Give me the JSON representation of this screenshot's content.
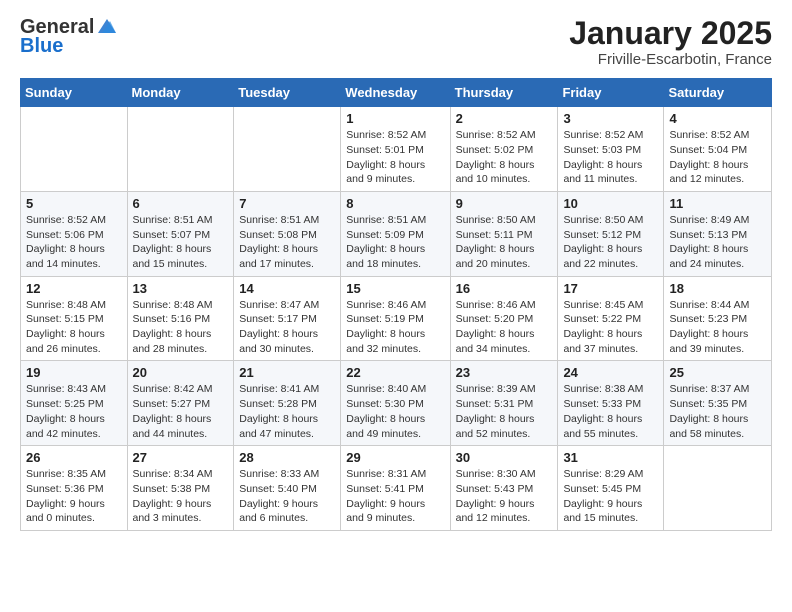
{
  "logo": {
    "line1": "General",
    "line2": "Blue"
  },
  "title": "January 2025",
  "subtitle": "Friville-Escarbotin, France",
  "days_of_week": [
    "Sunday",
    "Monday",
    "Tuesday",
    "Wednesday",
    "Thursday",
    "Friday",
    "Saturday"
  ],
  "weeks": [
    [
      {
        "day": "",
        "sunrise": "",
        "sunset": "",
        "daylight": ""
      },
      {
        "day": "",
        "sunrise": "",
        "sunset": "",
        "daylight": ""
      },
      {
        "day": "",
        "sunrise": "",
        "sunset": "",
        "daylight": ""
      },
      {
        "day": "1",
        "sunrise": "Sunrise: 8:52 AM",
        "sunset": "Sunset: 5:01 PM",
        "daylight": "Daylight: 8 hours and 9 minutes."
      },
      {
        "day": "2",
        "sunrise": "Sunrise: 8:52 AM",
        "sunset": "Sunset: 5:02 PM",
        "daylight": "Daylight: 8 hours and 10 minutes."
      },
      {
        "day": "3",
        "sunrise": "Sunrise: 8:52 AM",
        "sunset": "Sunset: 5:03 PM",
        "daylight": "Daylight: 8 hours and 11 minutes."
      },
      {
        "day": "4",
        "sunrise": "Sunrise: 8:52 AM",
        "sunset": "Sunset: 5:04 PM",
        "daylight": "Daylight: 8 hours and 12 minutes."
      }
    ],
    [
      {
        "day": "5",
        "sunrise": "Sunrise: 8:52 AM",
        "sunset": "Sunset: 5:06 PM",
        "daylight": "Daylight: 8 hours and 14 minutes."
      },
      {
        "day": "6",
        "sunrise": "Sunrise: 8:51 AM",
        "sunset": "Sunset: 5:07 PM",
        "daylight": "Daylight: 8 hours and 15 minutes."
      },
      {
        "day": "7",
        "sunrise": "Sunrise: 8:51 AM",
        "sunset": "Sunset: 5:08 PM",
        "daylight": "Daylight: 8 hours and 17 minutes."
      },
      {
        "day": "8",
        "sunrise": "Sunrise: 8:51 AM",
        "sunset": "Sunset: 5:09 PM",
        "daylight": "Daylight: 8 hours and 18 minutes."
      },
      {
        "day": "9",
        "sunrise": "Sunrise: 8:50 AM",
        "sunset": "Sunset: 5:11 PM",
        "daylight": "Daylight: 8 hours and 20 minutes."
      },
      {
        "day": "10",
        "sunrise": "Sunrise: 8:50 AM",
        "sunset": "Sunset: 5:12 PM",
        "daylight": "Daylight: 8 hours and 22 minutes."
      },
      {
        "day": "11",
        "sunrise": "Sunrise: 8:49 AM",
        "sunset": "Sunset: 5:13 PM",
        "daylight": "Daylight: 8 hours and 24 minutes."
      }
    ],
    [
      {
        "day": "12",
        "sunrise": "Sunrise: 8:48 AM",
        "sunset": "Sunset: 5:15 PM",
        "daylight": "Daylight: 8 hours and 26 minutes."
      },
      {
        "day": "13",
        "sunrise": "Sunrise: 8:48 AM",
        "sunset": "Sunset: 5:16 PM",
        "daylight": "Daylight: 8 hours and 28 minutes."
      },
      {
        "day": "14",
        "sunrise": "Sunrise: 8:47 AM",
        "sunset": "Sunset: 5:17 PM",
        "daylight": "Daylight: 8 hours and 30 minutes."
      },
      {
        "day": "15",
        "sunrise": "Sunrise: 8:46 AM",
        "sunset": "Sunset: 5:19 PM",
        "daylight": "Daylight: 8 hours and 32 minutes."
      },
      {
        "day": "16",
        "sunrise": "Sunrise: 8:46 AM",
        "sunset": "Sunset: 5:20 PM",
        "daylight": "Daylight: 8 hours and 34 minutes."
      },
      {
        "day": "17",
        "sunrise": "Sunrise: 8:45 AM",
        "sunset": "Sunset: 5:22 PM",
        "daylight": "Daylight: 8 hours and 37 minutes."
      },
      {
        "day": "18",
        "sunrise": "Sunrise: 8:44 AM",
        "sunset": "Sunset: 5:23 PM",
        "daylight": "Daylight: 8 hours and 39 minutes."
      }
    ],
    [
      {
        "day": "19",
        "sunrise": "Sunrise: 8:43 AM",
        "sunset": "Sunset: 5:25 PM",
        "daylight": "Daylight: 8 hours and 42 minutes."
      },
      {
        "day": "20",
        "sunrise": "Sunrise: 8:42 AM",
        "sunset": "Sunset: 5:27 PM",
        "daylight": "Daylight: 8 hours and 44 minutes."
      },
      {
        "day": "21",
        "sunrise": "Sunrise: 8:41 AM",
        "sunset": "Sunset: 5:28 PM",
        "daylight": "Daylight: 8 hours and 47 minutes."
      },
      {
        "day": "22",
        "sunrise": "Sunrise: 8:40 AM",
        "sunset": "Sunset: 5:30 PM",
        "daylight": "Daylight: 8 hours and 49 minutes."
      },
      {
        "day": "23",
        "sunrise": "Sunrise: 8:39 AM",
        "sunset": "Sunset: 5:31 PM",
        "daylight": "Daylight: 8 hours and 52 minutes."
      },
      {
        "day": "24",
        "sunrise": "Sunrise: 8:38 AM",
        "sunset": "Sunset: 5:33 PM",
        "daylight": "Daylight: 8 hours and 55 minutes."
      },
      {
        "day": "25",
        "sunrise": "Sunrise: 8:37 AM",
        "sunset": "Sunset: 5:35 PM",
        "daylight": "Daylight: 8 hours and 58 minutes."
      }
    ],
    [
      {
        "day": "26",
        "sunrise": "Sunrise: 8:35 AM",
        "sunset": "Sunset: 5:36 PM",
        "daylight": "Daylight: 9 hours and 0 minutes."
      },
      {
        "day": "27",
        "sunrise": "Sunrise: 8:34 AM",
        "sunset": "Sunset: 5:38 PM",
        "daylight": "Daylight: 9 hours and 3 minutes."
      },
      {
        "day": "28",
        "sunrise": "Sunrise: 8:33 AM",
        "sunset": "Sunset: 5:40 PM",
        "daylight": "Daylight: 9 hours and 6 minutes."
      },
      {
        "day": "29",
        "sunrise": "Sunrise: 8:31 AM",
        "sunset": "Sunset: 5:41 PM",
        "daylight": "Daylight: 9 hours and 9 minutes."
      },
      {
        "day": "30",
        "sunrise": "Sunrise: 8:30 AM",
        "sunset": "Sunset: 5:43 PM",
        "daylight": "Daylight: 9 hours and 12 minutes."
      },
      {
        "day": "31",
        "sunrise": "Sunrise: 8:29 AM",
        "sunset": "Sunset: 5:45 PM",
        "daylight": "Daylight: 9 hours and 15 minutes."
      },
      {
        "day": "",
        "sunrise": "",
        "sunset": "",
        "daylight": ""
      }
    ]
  ]
}
